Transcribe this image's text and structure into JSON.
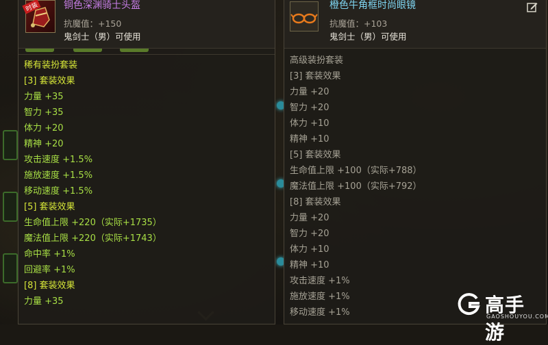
{
  "left_tooltip": {
    "badge": "时装",
    "item_name": "铜色深渊骑士头盔",
    "resist": "抗魔值：+150",
    "usable": "鬼剑士（男）可使用",
    "lines": [
      "稀有装扮套装",
      "[3] 套装效果",
      "力量 +35",
      "智力 +35",
      "体力 +20",
      "精神 +20",
      "攻击速度 +1.5%",
      "施放速度 +1.5%",
      "移动速度 +1.5%",
      "[5] 套装效果",
      "生命值上限 +220（实际+1735）",
      "魔法值上限 +220（实际+1743）",
      "命中率 +1%",
      "回避率 +1%",
      "[8] 套装效果",
      "力量 +35"
    ]
  },
  "right_tooltip": {
    "item_name": "橙色牛角框时尚眼镜",
    "resist": "抗魔值：+103",
    "usable": "鬼剑士（男）可使用",
    "edit_icon": "edit-icon",
    "lines": [
      "高级装扮套装",
      "[3] 套装效果",
      "力量 +20",
      "智力 +20",
      "体力 +10",
      "精神 +10",
      "[5] 套装效果",
      "生命值上限 +100（实际+788）",
      "魔法值上限 +100（实际+792）",
      "[8] 套装效果",
      "力量 +20",
      "智力 +20",
      "体力 +10",
      "精神 +10",
      "攻击速度 +1%",
      "施放速度 +1%",
      "移动速度 +1%"
    ]
  },
  "watermark": {
    "name": "高手游",
    "domain": "GAOSHOUYOU.COM"
  },
  "colors": {
    "rare_name": "#c77ee6",
    "epic_name": "#7fd6f2",
    "set_green": "#a8df45",
    "set_gray": "#a6a295"
  }
}
